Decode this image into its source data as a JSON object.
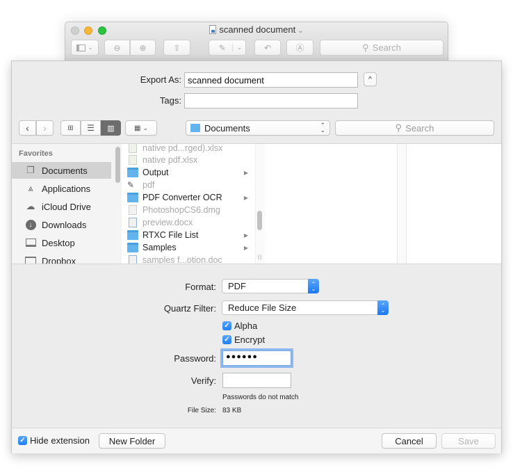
{
  "preview_window": {
    "title": "scanned document",
    "toolbar": {
      "search_placeholder": "Search"
    }
  },
  "save_sheet": {
    "export_as_label": "Export As:",
    "export_as_value": "scanned document",
    "tags_label": "Tags:",
    "tags_value": "",
    "location": "Documents",
    "search_placeholder": "Search",
    "sidebar": {
      "header": "Favorites",
      "items": [
        {
          "label": "Documents",
          "icon": "documents-icon",
          "selected": true
        },
        {
          "label": "Applications",
          "icon": "applications-icon"
        },
        {
          "label": "iCloud Drive",
          "icon": "icloud-icon"
        },
        {
          "label": "Downloads",
          "icon": "downloads-icon"
        },
        {
          "label": "Desktop",
          "icon": "desktop-icon"
        },
        {
          "label": "Dropbox",
          "icon": "dropbox-folder-icon"
        }
      ]
    },
    "files": [
      {
        "name": "native pd...rged).xlsx",
        "type": "xlsx",
        "enabled": false
      },
      {
        "name": "native pdf.xlsx",
        "type": "xlsx",
        "enabled": false
      },
      {
        "name": "Output",
        "type": "folder",
        "enabled": true
      },
      {
        "name": "pdf",
        "type": "app",
        "enabled": false
      },
      {
        "name": "PDF Converter OCR",
        "type": "folder",
        "enabled": true
      },
      {
        "name": "PhotoshopCS6.dmg",
        "type": "dmg",
        "enabled": false
      },
      {
        "name": "preview.docx",
        "type": "docx",
        "enabled": false
      },
      {
        "name": "RTXC File List",
        "type": "folder",
        "enabled": true
      },
      {
        "name": "Samples",
        "type": "folder",
        "enabled": true
      },
      {
        "name": "samples f...otion.doc",
        "type": "doc",
        "enabled": false
      }
    ],
    "format_label": "Format:",
    "format_value": "PDF",
    "quartz_label": "Quartz Filter:",
    "quartz_value": "Reduce File Size",
    "alpha_label": "Alpha",
    "alpha_checked": true,
    "encrypt_label": "Encrypt",
    "encrypt_checked": true,
    "password_label": "Password:",
    "password_value": "●●●●●●",
    "verify_label": "Verify:",
    "verify_value": "",
    "mismatch_message": "Passwords do not match",
    "file_size_label": "File Size:",
    "file_size_value": "83 KB",
    "hide_extension_label": "Hide extension",
    "hide_extension_checked": true,
    "new_folder_label": "New Folder",
    "cancel_label": "Cancel",
    "save_label": "Save"
  }
}
